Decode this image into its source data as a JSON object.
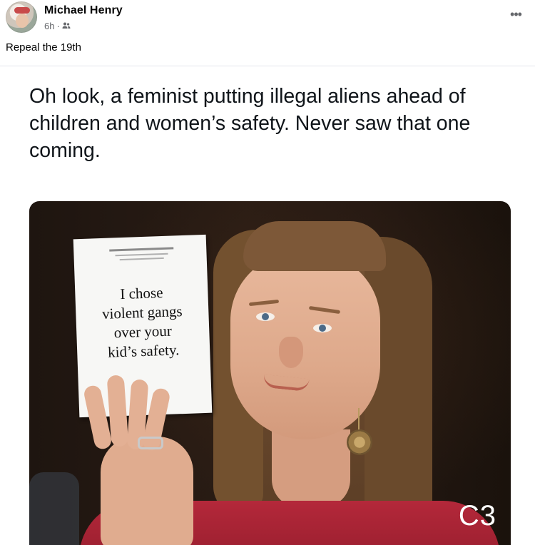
{
  "post": {
    "author_name": "Michael Henry",
    "timestamp": "6h",
    "separator": "·",
    "audience_icon": "friends-icon",
    "more_label": "•••",
    "caption": "Repeal the 19th"
  },
  "tweet": {
    "text": "Oh look, a feminist putting illegal aliens ahead of children and women’s safety. Never saw that one coming."
  },
  "meme": {
    "card_text": "I chose\nviolent gangs\nover your\nkid’s safety.",
    "watermark": "C3"
  },
  "colors": {
    "name_text": "#050505",
    "meta_text": "#65676b",
    "jacket": "#b4283a",
    "image_bg": "#1e1510"
  }
}
